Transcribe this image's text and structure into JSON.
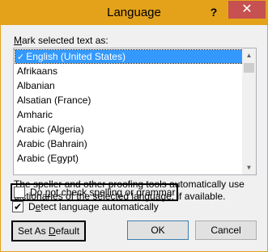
{
  "window": {
    "title": "Language",
    "help_glyph": "?",
    "close_glyph": "✕",
    "accent_color": "#e3a21a"
  },
  "mark_label": {
    "pre": "",
    "access_key": "M",
    "post": "ark selected text as:"
  },
  "languages": [
    "English (United States)",
    "Afrikaans",
    "Albanian",
    "Alsatian (France)",
    "Amharic",
    "Arabic (Algeria)",
    "Arabic (Bahrain)",
    "Arabic (Egypt)"
  ],
  "selected_index": 0,
  "info_text": "The speller and other proofing tools automatically use dictionaries of the selected language, if available.",
  "options": {
    "no_check": {
      "pre": "Do ",
      "access_key": "n",
      "post": "ot check spelling or grammar",
      "checked": false
    },
    "detect": {
      "pre": "D",
      "access_key": "e",
      "post": "tect language automatically",
      "checked": true
    }
  },
  "buttons": {
    "set_default": {
      "pre": "Set As ",
      "access_key": "D",
      "post": "efault"
    },
    "ok": "OK",
    "cancel": "Cancel"
  }
}
